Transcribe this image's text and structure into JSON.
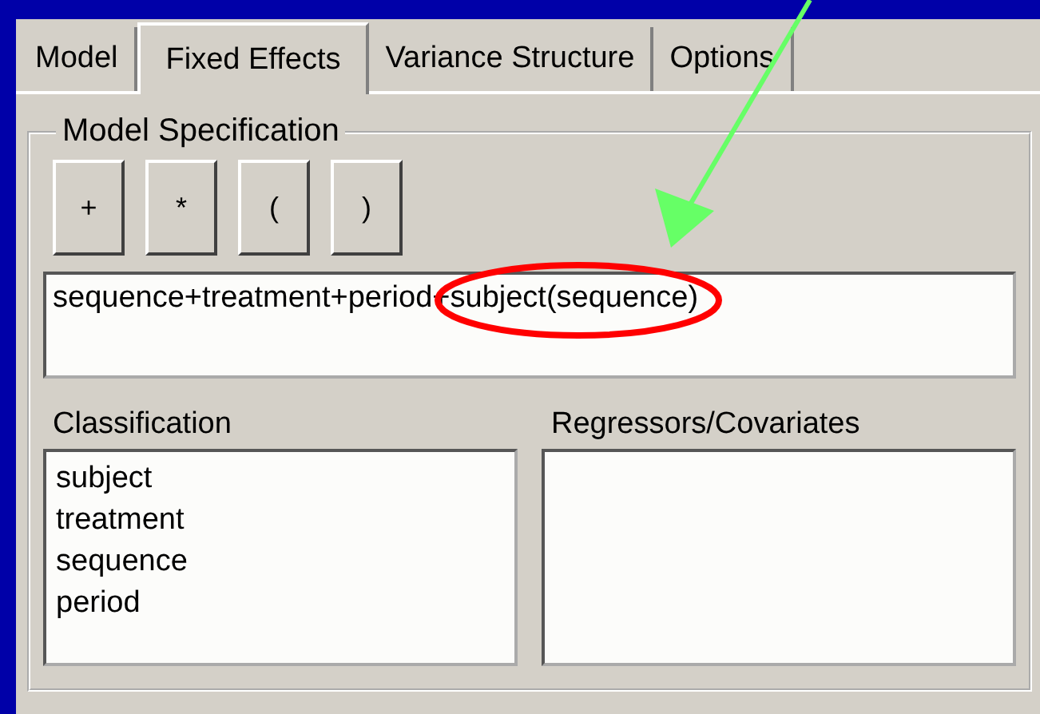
{
  "tabs": [
    {
      "label": "Model",
      "selected": false
    },
    {
      "label": "Fixed Effects",
      "selected": true
    },
    {
      "label": "Variance Structure",
      "selected": false
    },
    {
      "label": "Options",
      "selected": false
    }
  ],
  "group": {
    "title": "Model Specification",
    "operator_buttons": [
      "+",
      "*",
      "(",
      ")"
    ],
    "model_field": {
      "value": "sequence+treatment+period+subject(sequence)"
    },
    "classification": {
      "label": "Classification",
      "items": [
        "subject",
        "treatment",
        "sequence",
        "period"
      ]
    },
    "regressors": {
      "label": "Regressors/Covariates"
    }
  },
  "annotations": [
    {
      "kind": "arrow",
      "color": "#66ff66"
    },
    {
      "kind": "ellipse",
      "color": "#ff0000"
    }
  ]
}
